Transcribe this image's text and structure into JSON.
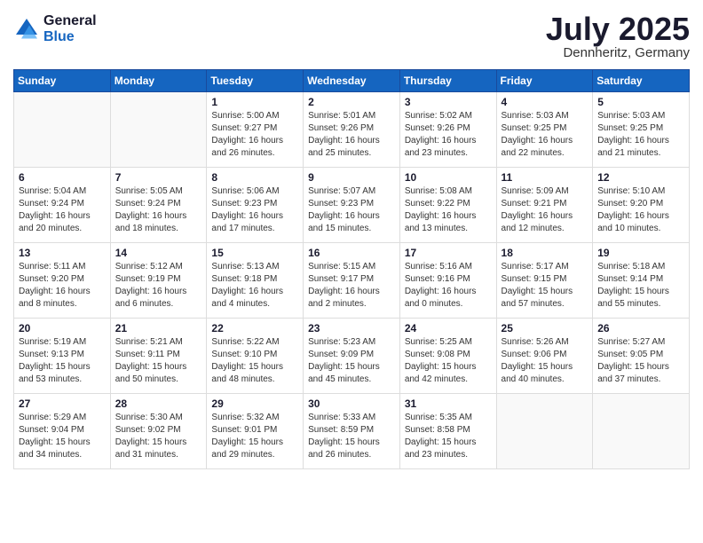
{
  "header": {
    "logo_line1": "General",
    "logo_line2": "Blue",
    "month": "July 2025",
    "location": "Dennheritz, Germany"
  },
  "days_of_week": [
    "Sunday",
    "Monday",
    "Tuesday",
    "Wednesday",
    "Thursday",
    "Friday",
    "Saturday"
  ],
  "weeks": [
    [
      {
        "day": "",
        "info": ""
      },
      {
        "day": "",
        "info": ""
      },
      {
        "day": "1",
        "info": "Sunrise: 5:00 AM\nSunset: 9:27 PM\nDaylight: 16 hours\nand 26 minutes."
      },
      {
        "day": "2",
        "info": "Sunrise: 5:01 AM\nSunset: 9:26 PM\nDaylight: 16 hours\nand 25 minutes."
      },
      {
        "day": "3",
        "info": "Sunrise: 5:02 AM\nSunset: 9:26 PM\nDaylight: 16 hours\nand 23 minutes."
      },
      {
        "day": "4",
        "info": "Sunrise: 5:03 AM\nSunset: 9:25 PM\nDaylight: 16 hours\nand 22 minutes."
      },
      {
        "day": "5",
        "info": "Sunrise: 5:03 AM\nSunset: 9:25 PM\nDaylight: 16 hours\nand 21 minutes."
      }
    ],
    [
      {
        "day": "6",
        "info": "Sunrise: 5:04 AM\nSunset: 9:24 PM\nDaylight: 16 hours\nand 20 minutes."
      },
      {
        "day": "7",
        "info": "Sunrise: 5:05 AM\nSunset: 9:24 PM\nDaylight: 16 hours\nand 18 minutes."
      },
      {
        "day": "8",
        "info": "Sunrise: 5:06 AM\nSunset: 9:23 PM\nDaylight: 16 hours\nand 17 minutes."
      },
      {
        "day": "9",
        "info": "Sunrise: 5:07 AM\nSunset: 9:23 PM\nDaylight: 16 hours\nand 15 minutes."
      },
      {
        "day": "10",
        "info": "Sunrise: 5:08 AM\nSunset: 9:22 PM\nDaylight: 16 hours\nand 13 minutes."
      },
      {
        "day": "11",
        "info": "Sunrise: 5:09 AM\nSunset: 9:21 PM\nDaylight: 16 hours\nand 12 minutes."
      },
      {
        "day": "12",
        "info": "Sunrise: 5:10 AM\nSunset: 9:20 PM\nDaylight: 16 hours\nand 10 minutes."
      }
    ],
    [
      {
        "day": "13",
        "info": "Sunrise: 5:11 AM\nSunset: 9:20 PM\nDaylight: 16 hours\nand 8 minutes."
      },
      {
        "day": "14",
        "info": "Sunrise: 5:12 AM\nSunset: 9:19 PM\nDaylight: 16 hours\nand 6 minutes."
      },
      {
        "day": "15",
        "info": "Sunrise: 5:13 AM\nSunset: 9:18 PM\nDaylight: 16 hours\nand 4 minutes."
      },
      {
        "day": "16",
        "info": "Sunrise: 5:15 AM\nSunset: 9:17 PM\nDaylight: 16 hours\nand 2 minutes."
      },
      {
        "day": "17",
        "info": "Sunrise: 5:16 AM\nSunset: 9:16 PM\nDaylight: 16 hours\nand 0 minutes."
      },
      {
        "day": "18",
        "info": "Sunrise: 5:17 AM\nSunset: 9:15 PM\nDaylight: 15 hours\nand 57 minutes."
      },
      {
        "day": "19",
        "info": "Sunrise: 5:18 AM\nSunset: 9:14 PM\nDaylight: 15 hours\nand 55 minutes."
      }
    ],
    [
      {
        "day": "20",
        "info": "Sunrise: 5:19 AM\nSunset: 9:13 PM\nDaylight: 15 hours\nand 53 minutes."
      },
      {
        "day": "21",
        "info": "Sunrise: 5:21 AM\nSunset: 9:11 PM\nDaylight: 15 hours\nand 50 minutes."
      },
      {
        "day": "22",
        "info": "Sunrise: 5:22 AM\nSunset: 9:10 PM\nDaylight: 15 hours\nand 48 minutes."
      },
      {
        "day": "23",
        "info": "Sunrise: 5:23 AM\nSunset: 9:09 PM\nDaylight: 15 hours\nand 45 minutes."
      },
      {
        "day": "24",
        "info": "Sunrise: 5:25 AM\nSunset: 9:08 PM\nDaylight: 15 hours\nand 42 minutes."
      },
      {
        "day": "25",
        "info": "Sunrise: 5:26 AM\nSunset: 9:06 PM\nDaylight: 15 hours\nand 40 minutes."
      },
      {
        "day": "26",
        "info": "Sunrise: 5:27 AM\nSunset: 9:05 PM\nDaylight: 15 hours\nand 37 minutes."
      }
    ],
    [
      {
        "day": "27",
        "info": "Sunrise: 5:29 AM\nSunset: 9:04 PM\nDaylight: 15 hours\nand 34 minutes."
      },
      {
        "day": "28",
        "info": "Sunrise: 5:30 AM\nSunset: 9:02 PM\nDaylight: 15 hours\nand 31 minutes."
      },
      {
        "day": "29",
        "info": "Sunrise: 5:32 AM\nSunset: 9:01 PM\nDaylight: 15 hours\nand 29 minutes."
      },
      {
        "day": "30",
        "info": "Sunrise: 5:33 AM\nSunset: 8:59 PM\nDaylight: 15 hours\nand 26 minutes."
      },
      {
        "day": "31",
        "info": "Sunrise: 5:35 AM\nSunset: 8:58 PM\nDaylight: 15 hours\nand 23 minutes."
      },
      {
        "day": "",
        "info": ""
      },
      {
        "day": "",
        "info": ""
      }
    ]
  ]
}
